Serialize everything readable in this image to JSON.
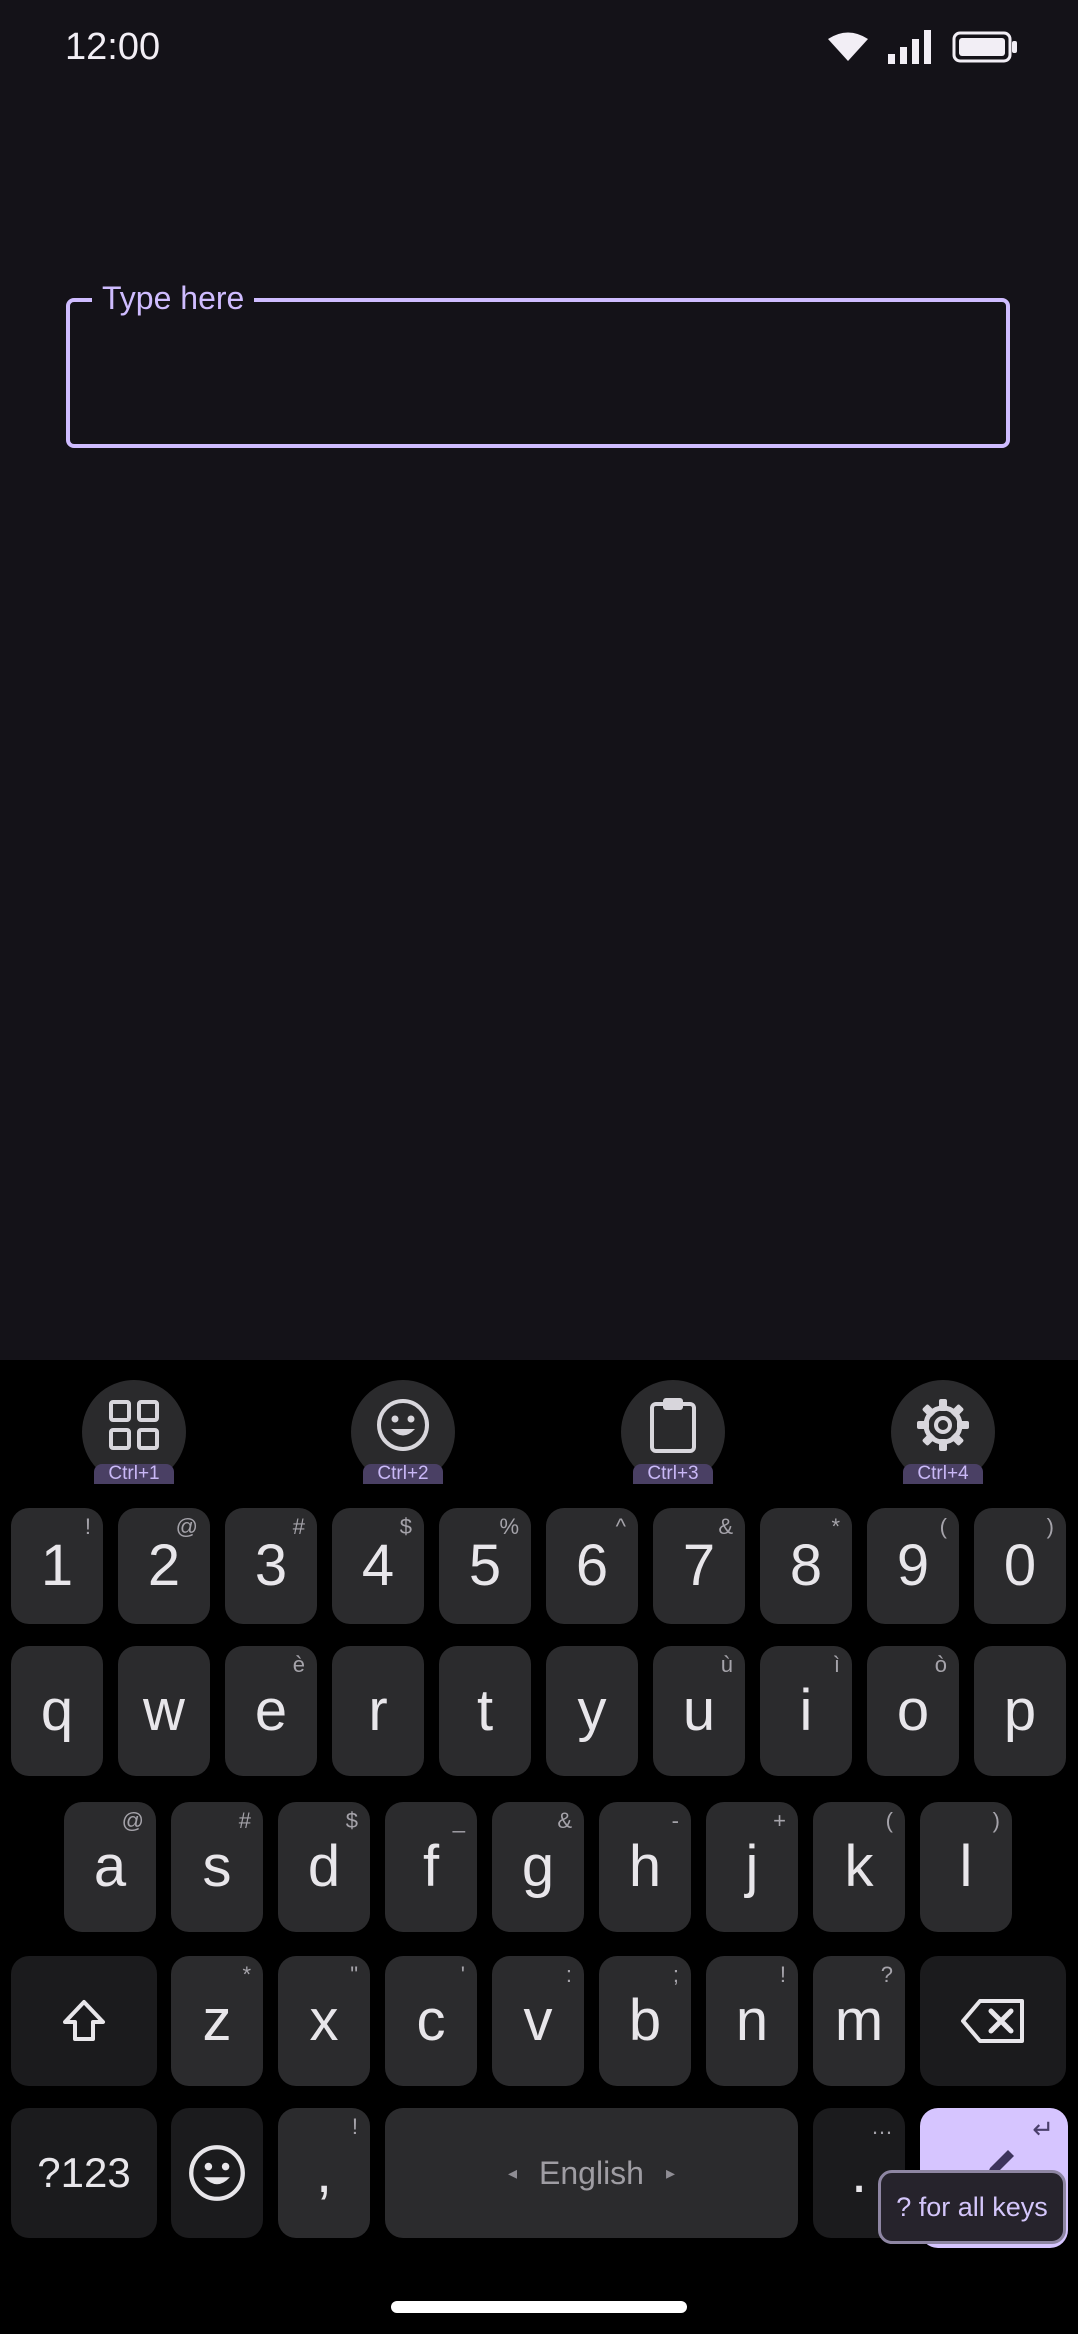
{
  "status_bar": {
    "time": "12:00",
    "icons": [
      "wifi-icon",
      "signal-icon",
      "battery-icon"
    ]
  },
  "text_field": {
    "label": "Type here",
    "value": ""
  },
  "keyboard": {
    "toolbar": [
      {
        "icon": "grid-icon",
        "shortcut": "Ctrl+1"
      },
      {
        "icon": "emoji-icon",
        "shortcut": "Ctrl+2"
      },
      {
        "icon": "clipboard-icon",
        "shortcut": "Ctrl+3"
      },
      {
        "icon": "gear-icon",
        "shortcut": "Ctrl+4"
      }
    ],
    "rows": {
      "numbers": [
        {
          "label": "1",
          "hint": "!"
        },
        {
          "label": "2",
          "hint": "@"
        },
        {
          "label": "3",
          "hint": "#"
        },
        {
          "label": "4",
          "hint": "$"
        },
        {
          "label": "5",
          "hint": "%"
        },
        {
          "label": "6",
          "hint": "^"
        },
        {
          "label": "7",
          "hint": "&"
        },
        {
          "label": "8",
          "hint": "*"
        },
        {
          "label": "9",
          "hint": "("
        },
        {
          "label": "0",
          "hint": ")"
        }
      ],
      "row1": [
        {
          "label": "q",
          "hint": ""
        },
        {
          "label": "w",
          "hint": ""
        },
        {
          "label": "e",
          "hint": "è"
        },
        {
          "label": "r",
          "hint": ""
        },
        {
          "label": "t",
          "hint": ""
        },
        {
          "label": "y",
          "hint": ""
        },
        {
          "label": "u",
          "hint": "ù"
        },
        {
          "label": "i",
          "hint": "ì"
        },
        {
          "label": "o",
          "hint": "ò"
        },
        {
          "label": "p",
          "hint": ""
        }
      ],
      "row2": [
        {
          "label": "a",
          "hint": "@"
        },
        {
          "label": "s",
          "hint": "#"
        },
        {
          "label": "d",
          "hint": "$"
        },
        {
          "label": "f",
          "hint": "_"
        },
        {
          "label": "g",
          "hint": "&"
        },
        {
          "label": "h",
          "hint": "-"
        },
        {
          "label": "j",
          "hint": "+"
        },
        {
          "label": "k",
          "hint": "("
        },
        {
          "label": "l",
          "hint": ")"
        }
      ],
      "row3": [
        {
          "label": "z",
          "hint": "*"
        },
        {
          "label": "x",
          "hint": "\""
        },
        {
          "label": "c",
          "hint": "'"
        },
        {
          "label": "v",
          "hint": ":"
        },
        {
          "label": "b",
          "hint": ";"
        },
        {
          "label": "n",
          "hint": "!"
        },
        {
          "label": "m",
          "hint": "?"
        }
      ]
    },
    "shift_icon": "shift-icon",
    "backspace_icon": "backspace-icon",
    "symbols_label": "?123",
    "emoji_key_icon": "emoji-icon",
    "comma": {
      "label": ",",
      "hint": "!"
    },
    "space": {
      "label": "English",
      "left_arrow": "◂",
      "right_arrow": "▸"
    },
    "period": {
      "label": ".",
      "hint": "…"
    },
    "enter": {
      "hint": "↵",
      "icon": "pencil-icon"
    },
    "tooltip": "? for all keys"
  }
}
